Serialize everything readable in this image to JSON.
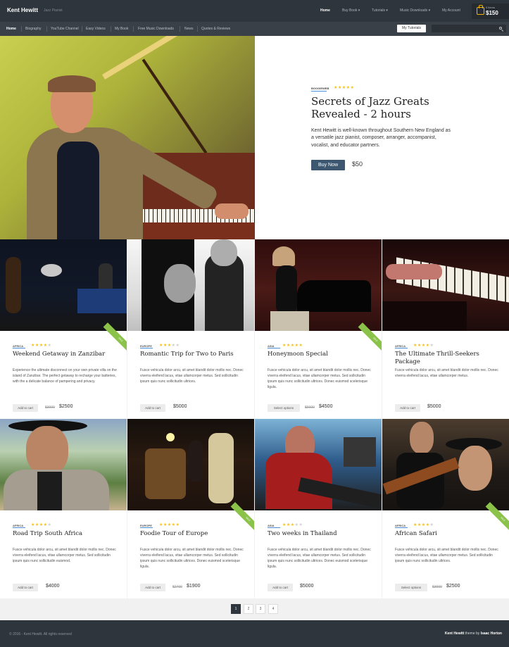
{
  "site": {
    "brand": "Kent Hewitt",
    "tagline": "Jazz Pianist",
    "top_nav": [
      "Home",
      "Buy Book ▾",
      "Tutorials ▾",
      "Music Downloads ▾",
      "My Account"
    ],
    "cart": {
      "items": "0 items",
      "total": "$150"
    }
  },
  "subnav": {
    "items": [
      "Home",
      "Biography",
      "YouTube Channel",
      "Easy Videos",
      "My Book",
      "Free Music Downloads",
      "News",
      "Quotes & Reviews"
    ],
    "button": "My Tutorials"
  },
  "hero": {
    "category": "BOOGIEWEB",
    "title": "Secrets of Jazz Greats Revealed - 2 hours",
    "text": "Kent Hewitt is well-known throughout Southern New England as a versatile jazz pianist, composer, arranger, accompanist, vocalist, and educator partners.",
    "button": "Buy Now",
    "price": "$50",
    "rating": 5
  },
  "products": [
    {
      "category": "AFRICA",
      "title": "Weekend Getaway in Zanzibar",
      "text": "Experience the ultimate disconnect on your own private villa on the island of Zanzibar. The perfect getaway to recharge your batteries, with the a delicate balance of pampering and privacy.",
      "button": "Add to cart",
      "old_price": "$3000",
      "price": "$2500",
      "sale": "SALE",
      "rating": 4
    },
    {
      "category": "EUROPE",
      "title": "Romantic Trip for Two to Paris",
      "text": "Fusce vehicula dolor arcu, sit amet blandit dolor mollis nec. Donec viverra eleifend lacus, vitae ullamcorper metus. Sed sollicitudin ipsum quis nunc sollicitudin ultrices.",
      "button": "Add to cart",
      "old_price": "",
      "price": "$5000",
      "sale": "",
      "rating": 3
    },
    {
      "category": "ASIA",
      "title": "Honeymoon Special",
      "text": "Fusce vehicula dolor arcu, sit amet blandit dolor mollis nec. Donec viverra eleifend lacus, vitae ullamcorper metus. Sed sollicitudin ipsum quis nunc sollicitudin ultrices. Donec euismod scelerisque ligula.",
      "button": "Select options",
      "old_price": "$6000",
      "price": "$4500",
      "sale": "SALE",
      "rating": 5
    },
    {
      "category": "AFRICA",
      "title": "The Ultimate Thrill-Seekers Package",
      "text": "Fusce vehicula dolor arcu, sit amet blandit dolor mollis nec. Donec viverra eleifend lacus, vitae ullamcorper metus.",
      "button": "Add to cart",
      "old_price": "",
      "price": "$5000",
      "sale": "",
      "rating": 4
    },
    {
      "category": "AFRICA",
      "title": "Road Trip South Africa",
      "text": "Fusce vehicula dolor arcu, sit amet blandit dolor mollis nec. Donec viverra eleifend lacus, vitae ullamcorper metus. Sed sollicitudin ipsum quis nunc sollicitudin euismod.",
      "button": "Add to cart",
      "old_price": "",
      "price": "$4000",
      "sale": "",
      "rating": 4
    },
    {
      "category": "EUROPE",
      "title": "Foodie Tour of Europe",
      "text": "Fusce vehicula dolor arcu, sit amet blandit dolor mollis nec. Donec viverra eleifend lacus, vitae ullamcorper metus. Sed sollicitudin ipsum quis nunc sollicitudin ultrices. Donec euismod scelerisque ligula.",
      "button": "Add to cart",
      "old_price": "$2700",
      "price": "$1900",
      "sale": "SALE",
      "rating": 5
    },
    {
      "category": "ASIA",
      "title": "Two weeks in Thailand",
      "text": "Fusce vehicula dolor arcu, sit amet blandit dolor mollis nec. Donec viverra eleifend lacus, vitae ullamcorper metus. Sed sollicitudin ipsum quis nunc sollicitudin ultrices. Donec euismod scelerisque ligula.",
      "button": "Add to cart",
      "old_price": "",
      "price": "$5000",
      "sale": "",
      "rating": 3
    },
    {
      "category": "AFRICA",
      "title": "African Safari",
      "text": "Fusce vehicula dolor arcu, sit amet blandit dolor mollis nec. Donec viverra eleifend lacus, vitae ullamcorper metus. Sed sollicitudin ipsum quis nunc sollicitudin ultrices.",
      "button": "Select options",
      "old_price": "$3000",
      "price": "$2500",
      "sale": "SALE",
      "rating": 4
    }
  ],
  "pagination": [
    "1",
    "2",
    "3",
    "4"
  ],
  "footer": {
    "copyright": "© 2016 - Kent Hewitt. All rights reserved",
    "credit_name": "Kent Hewitt",
    "credit_text": " theme by ",
    "credit_author": "Isaac Horton"
  },
  "colors": {
    "accent": "#3d5770",
    "star": "#f4c21b",
    "sale": "#8bc34a"
  }
}
